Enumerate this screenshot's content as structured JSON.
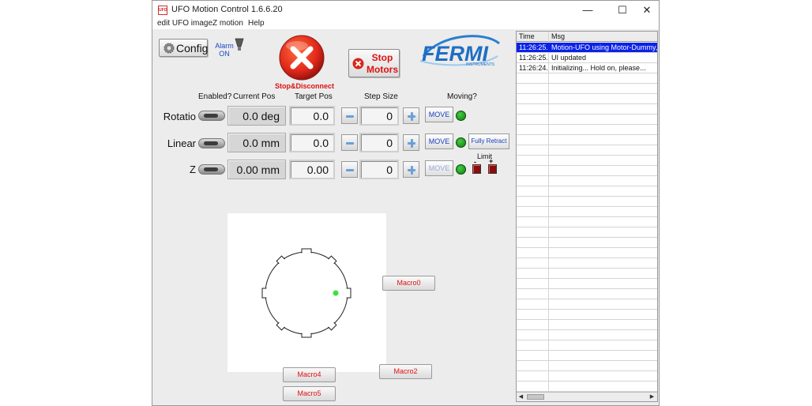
{
  "window": {
    "title": "UFO Motion Control 1.6.6.20",
    "app_logo_text": "UFO",
    "minimize": "—",
    "maximize": "☐",
    "close": "✕"
  },
  "menu": {
    "items": [
      "edit UFO image",
      "Z motion",
      "Help"
    ]
  },
  "toolbar": {
    "config_label": "Config",
    "alarm_label": "Alarm",
    "alarm_state": "ON",
    "stop_disconnect_label": "Stop&Disconnect",
    "stop_motors_label": "Stop Motors",
    "logo_text": "FERMI",
    "logo_subtext": "INSTRUMENTS"
  },
  "headers": {
    "enabled": "Enabled?",
    "current_pos": "Current Pos",
    "target_pos": "Target Pos",
    "step_size": "Step Size",
    "moving": "Moving?"
  },
  "axes": [
    {
      "name": "Rotatio",
      "current": "0.0 deg",
      "target": "0.0",
      "step": "0",
      "move_label": "MOVE"
    },
    {
      "name": "Linear",
      "current": "0.0 mm",
      "target": "0.0",
      "step": "0",
      "move_label": "MOVE"
    },
    {
      "name": "Z",
      "current": "0.00 mm",
      "target": "0.00",
      "step": "0",
      "move_label": "MOVE"
    }
  ],
  "fully_retract_label": "Fully Retract",
  "limit": {
    "label": "Limit",
    "minus": "-",
    "plus": "+"
  },
  "macros": {
    "macro0": "Macro0",
    "macro2": "Macro2",
    "macro4": "Macro4",
    "macro5": "Macro5"
  },
  "log": {
    "columns": [
      "Time",
      "Msg"
    ],
    "rows": [
      {
        "time": "11:26:25.",
        "msg": "Motion-UFO using Motor-Dummy,",
        "selected": true
      },
      {
        "time": "11:26:25.",
        "msg": "UI updated",
        "selected": false
      },
      {
        "time": "11:26:24.",
        "msg": "Initializing... Hold on, please...",
        "selected": false
      }
    ],
    "empty_rows": 31,
    "scroll_left": "◀",
    "scroll_right": "▶"
  },
  "colors": {
    "accent_blue": "#1840c0",
    "stop_red": "#d11111",
    "led_green": "#2bb52b",
    "log_selected": "#0a22e6"
  }
}
